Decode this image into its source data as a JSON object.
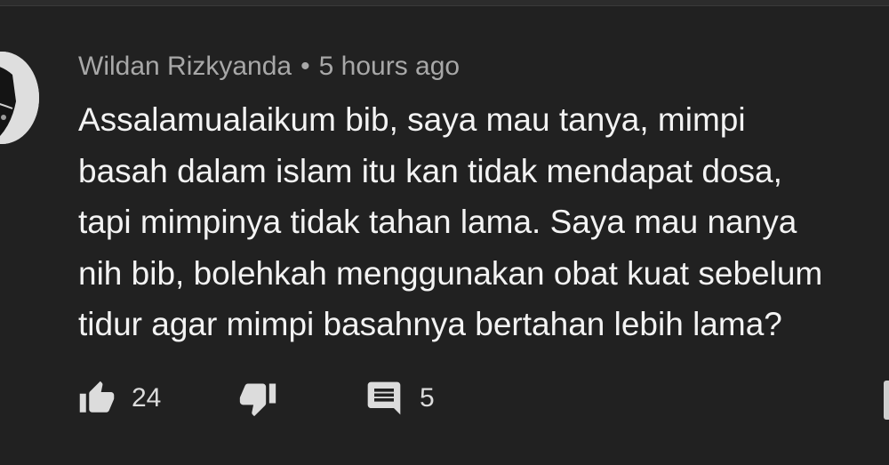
{
  "comment": {
    "author": "Wildan Rizkyanda",
    "separator": "•",
    "timestamp": "5 hours ago",
    "text_lines": [
      "Assalamualaikum bib, saya mau tanya, mimpi",
      "basah dalam islam itu kan tidak mendapat dosa,",
      "tapi mimpinya tidak tahan lama. Saya mau nanya",
      "nih bib, bolehkah menggunakan obat kuat sebelum",
      "tidur agar mimpi basahnya bertahan lebih lama?"
    ],
    "like_count": "24",
    "reply_count": "5"
  },
  "icons": {
    "like": "thumbs-up-icon",
    "dislike": "thumbs-down-icon",
    "reply": "comment-icon",
    "avatar": "avatar"
  },
  "colors": {
    "background": "#212121",
    "text": "#f3f3f3",
    "meta": "#a8a8a8",
    "icon": "#dcdcdc"
  }
}
